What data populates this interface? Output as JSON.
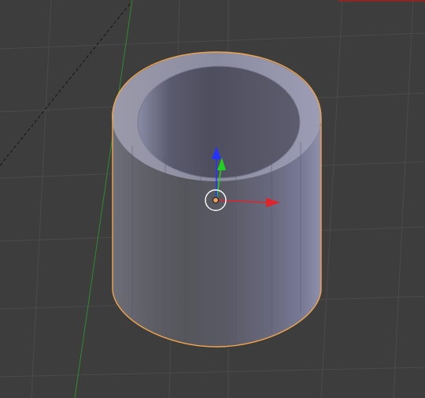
{
  "viewport": {
    "background": "#3d3d3d",
    "grid_color": "#4a4a4a",
    "y_axis_color": "#2e8b2e",
    "x_axis_color": "#9b2424",
    "selection_outline_color": "#f0a44c"
  },
  "object": {
    "type": "hollow-cylinder",
    "selected": true,
    "base_color": "#8e8fa6"
  },
  "gizmo": {
    "x_arrow_color": "#e0242c",
    "y_arrow_color": "#1fd21f",
    "z_arrow_color": "#2233ff",
    "origin_color": "#e8a05a",
    "ring_color": "#ffffff"
  },
  "icons": [
    "object-origin-icon",
    "translate-x-arrow-icon",
    "translate-y-arrow-icon",
    "translate-z-arrow-icon"
  ]
}
